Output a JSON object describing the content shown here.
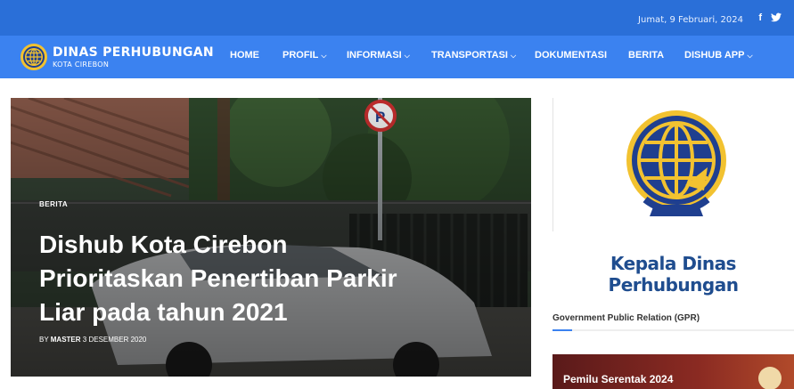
{
  "topbar": {
    "date": "Jumat, 9 Februari, 2024",
    "social": [
      {
        "icon": "facebook-icon",
        "glyph": "f"
      },
      {
        "icon": "twitter-icon",
        "glyph": "🐦"
      }
    ]
  },
  "brand": {
    "name": "DINAS PERHUBUNGAN",
    "subtitle": "KOTA CIREBON"
  },
  "nav": {
    "home": "HOME",
    "profil": "PROFIL",
    "informasi": "INFORMASI",
    "transportasi": "TRANSPORTASI",
    "dokumentasi": "DOKUMENTASI",
    "berita": "BERITA",
    "dishub_app": "DISHUB APP"
  },
  "hero": {
    "category": "BERITA",
    "title": "Dishub Kota Cirebon Prioritaskan Penertiban Parkir Liar pada tahun 2021",
    "by": "BY",
    "author": "MASTER",
    "date": "3 DESEMBER 2020"
  },
  "sidebar": {
    "kadis_title": "Kepala Dinas Perhubungan",
    "gpr_heading": "Government Public Relation (GPR)",
    "banner_text": "Pemilu Serentak 2024"
  },
  "colors": {
    "topbar": "#2a6fd8",
    "navbar": "#3b82f0",
    "emblem_blue": "#1f3f8f",
    "emblem_gold": "#f2c230"
  }
}
